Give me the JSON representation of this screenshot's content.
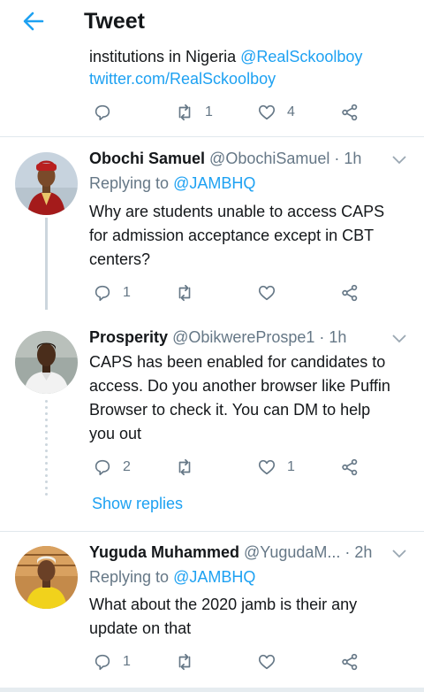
{
  "header": {
    "title": "Tweet"
  },
  "top_tweet": {
    "line1_text": "institutions in Nigeria ",
    "line1_mention": "@RealSckoolboy",
    "line2_link": "twitter.com/RealSckoolboy",
    "retweets": "1",
    "likes": "4"
  },
  "replies": [
    {
      "name": "Obochi Samuel",
      "handle": "@ObochiSamuel",
      "time": "· 1h",
      "replying_prefix": "Replying to ",
      "replying_to": "@JAMBHQ",
      "lines": [
        "Why are students unable to access CAPS",
        "for admission acceptance except in CBT",
        "centers?"
      ],
      "reply_count": "1",
      "retweet_count": "",
      "like_count": ""
    },
    {
      "name": "Prosperity",
      "handle": "@ObikwereProspe1",
      "time": "· 1h",
      "lines": [
        "CAPS has been enabled for candidates to",
        "access. Do you another browser like Puffin",
        "Browser to check it. You can DM to help",
        "you out"
      ],
      "reply_count": "2",
      "retweet_count": "",
      "like_count": "1",
      "show_replies": "Show replies"
    },
    {
      "name": "Yuguda Muhammed",
      "handle": "@YugudaM...",
      "time": "· 2h",
      "replying_prefix": "Replying to ",
      "replying_to": "@JAMBHQ",
      "lines": [
        "What about the 2020 jamb is their any",
        "update on that"
      ],
      "reply_count": "1",
      "retweet_count": "",
      "like_count": ""
    }
  ],
  "colors": {
    "accent": "#1da1f2",
    "secondary_text": "#657786",
    "divider": "#e1e8ed"
  },
  "icons": [
    "back-arrow-icon",
    "reply-icon",
    "retweet-icon",
    "like-icon",
    "share-icon",
    "chevron-down-icon"
  ]
}
